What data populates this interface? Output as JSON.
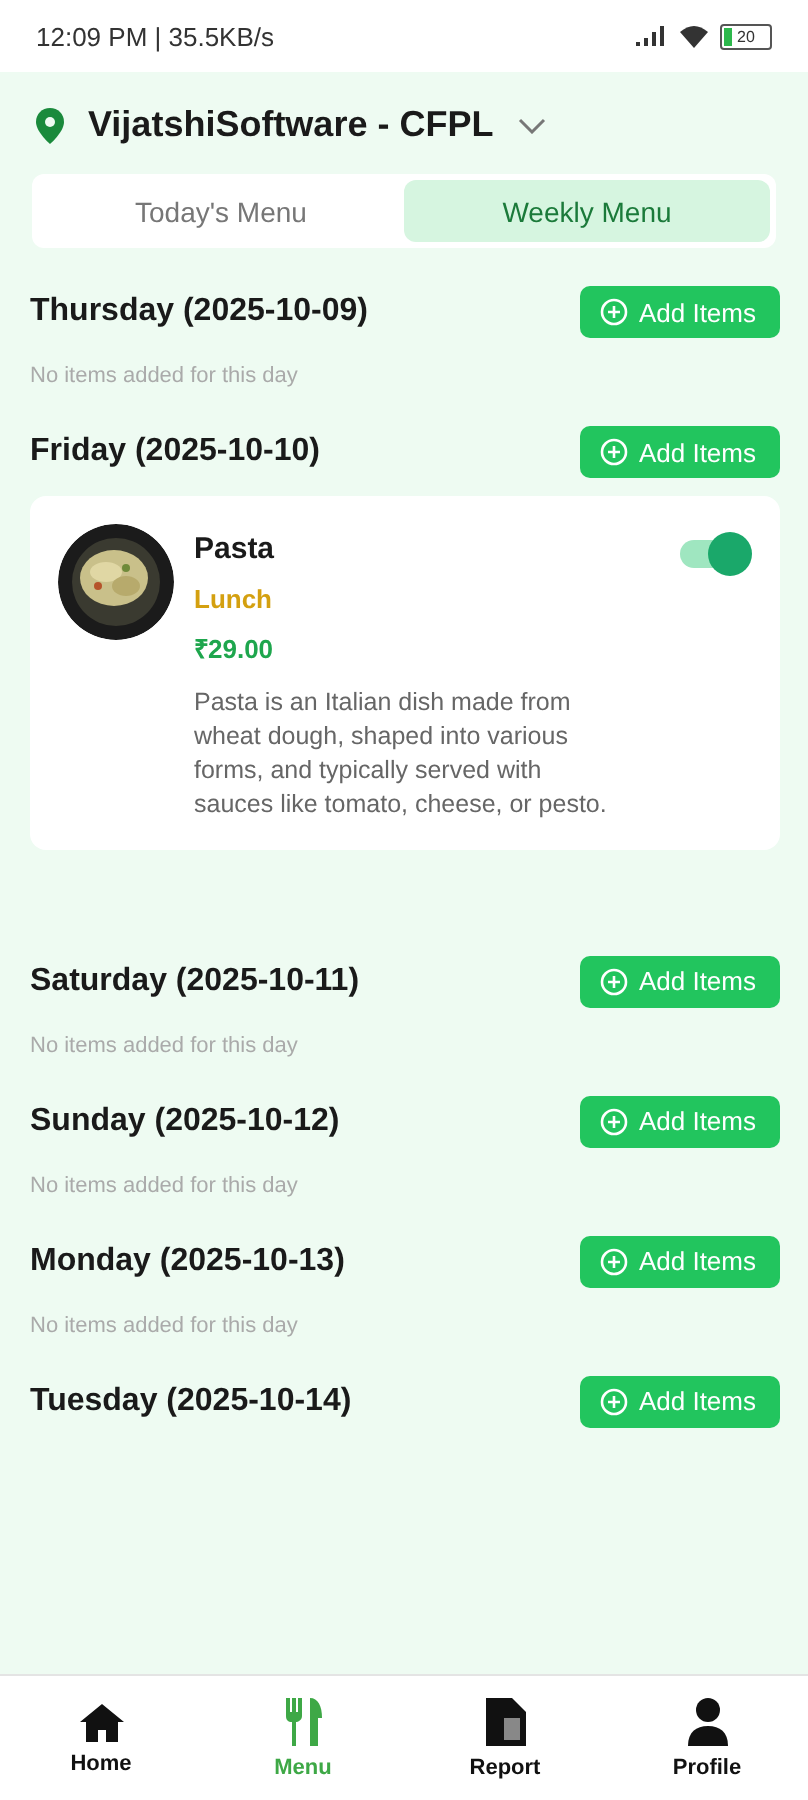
{
  "status_bar": {
    "time": "12:09 PM | 35.5KB/s",
    "battery": "20"
  },
  "header": {
    "location": "VijatshiSoftware - CFPL"
  },
  "tabs": [
    {
      "label": "Today's Menu",
      "selected": false
    },
    {
      "label": "Weekly Menu",
      "selected": true
    }
  ],
  "days": [
    {
      "title": "Thursday (2025-10-09)",
      "button": "Add Items",
      "empty_text": "No items added for this day"
    },
    {
      "title": "Friday (2025-10-10)",
      "button": "Add Items",
      "items": [
        {
          "name": "Pasta",
          "meal": "Lunch",
          "price": "₹29.00",
          "description": "Pasta is an Italian dish made from wheat dough, shaped into various forms, and typically served with sauces like tomato, cheese, or pesto.",
          "on": true
        }
      ]
    },
    {
      "title": "Saturday (2025-10-11)",
      "button": "Add Items",
      "empty_text": "No items added for this day"
    },
    {
      "title": "Sunday (2025-10-12)",
      "button": "Add Items",
      "empty_text": "No items added for this day"
    },
    {
      "title": "Monday (2025-10-13)",
      "button": "Add Items",
      "empty_text": "No items added for this day"
    },
    {
      "title": "Tuesday (2025-10-14)",
      "button": "Add Items"
    }
  ],
  "nav": [
    {
      "label": "Home",
      "kind": "home",
      "selected": false
    },
    {
      "label": "Menu",
      "kind": "menu",
      "selected": true
    },
    {
      "label": "Report",
      "kind": "report",
      "selected": false
    },
    {
      "label": "Profile",
      "kind": "profile",
      "selected": false
    }
  ]
}
